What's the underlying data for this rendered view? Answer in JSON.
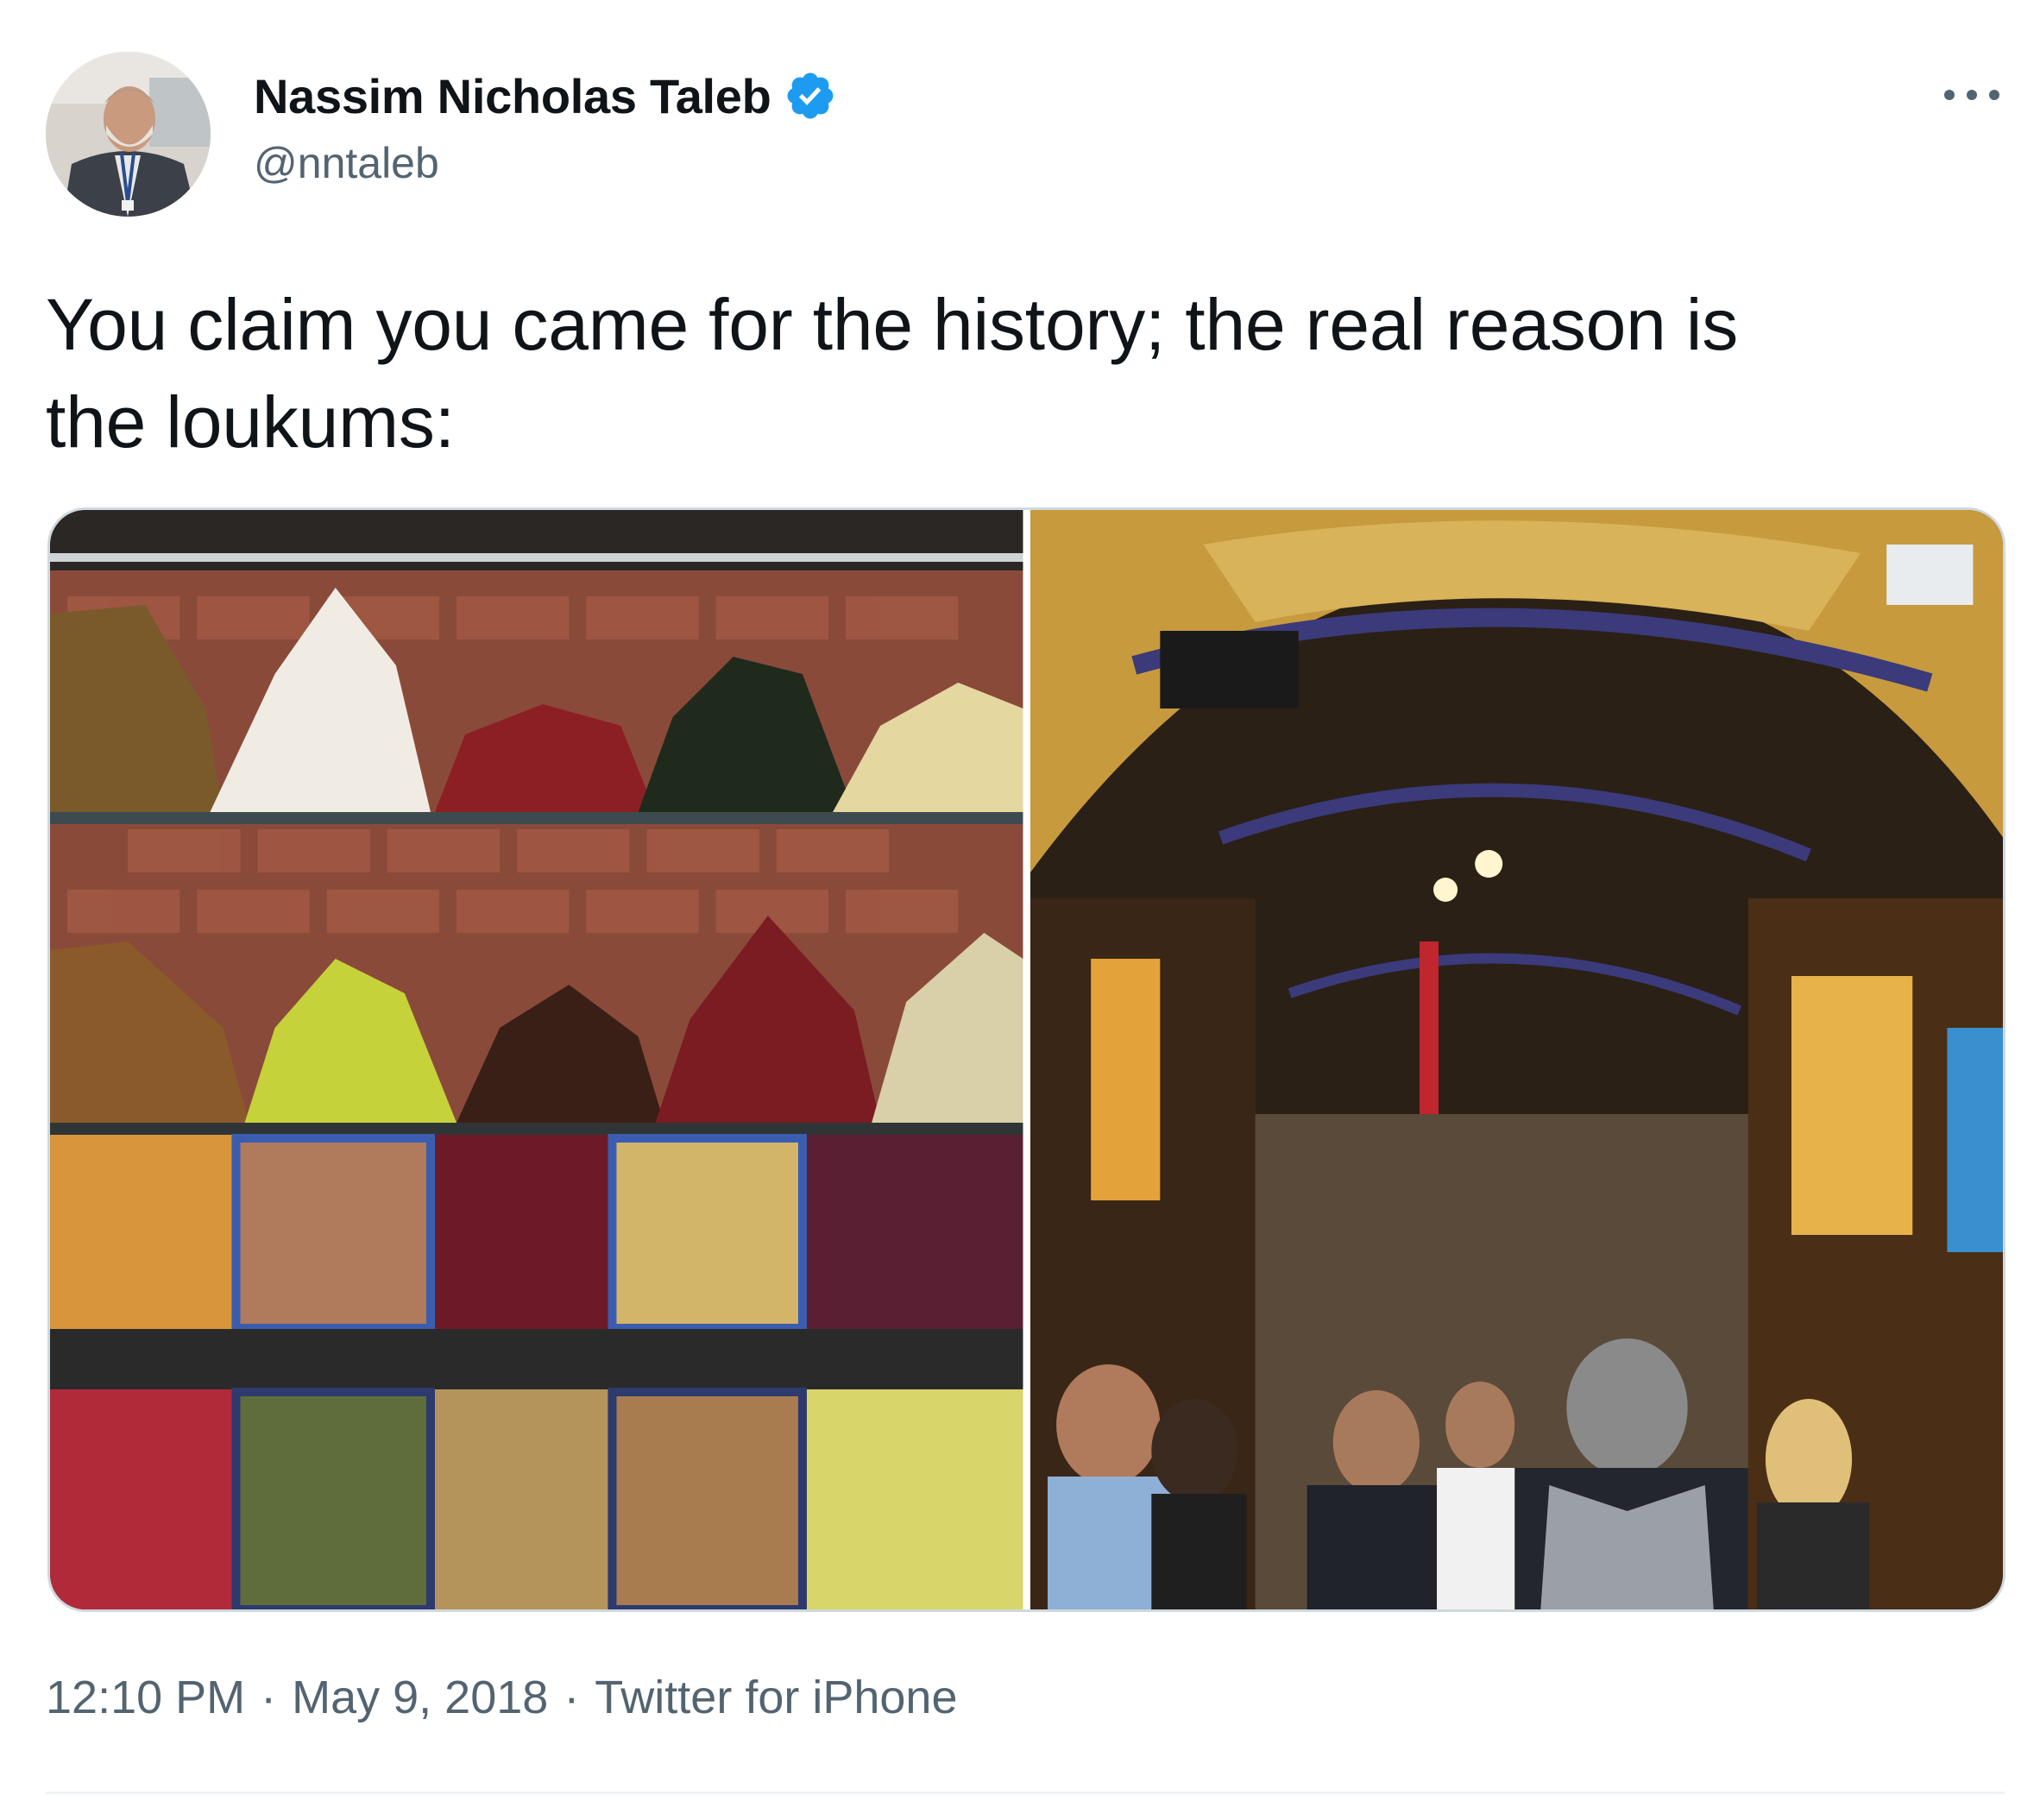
{
  "author": {
    "display_name": "Nassim Nicholas Taleb",
    "handle": "@nntaleb",
    "verified": true,
    "verified_color": "#1d9bf0",
    "avatar_icon": "profile-photo"
  },
  "more_icon": "more-horizontal-icon",
  "tweet": {
    "text_line1": "You claim you came for the history; the real reason is",
    "text_line2": "the loukums:"
  },
  "media": [
    {
      "kind": "photo",
      "subject": "loukum-display"
    },
    {
      "kind": "photo",
      "subject": "grand-bazaar-interior"
    }
  ],
  "meta": {
    "time": "12:10 PM",
    "separator": "·",
    "date": "May 9, 2018",
    "source": "Twitter for iPhone"
  },
  "colors": {
    "text_primary": "#0f1419",
    "text_secondary": "#536471",
    "border": "#cfd9de",
    "divider": "#eff3f4"
  }
}
